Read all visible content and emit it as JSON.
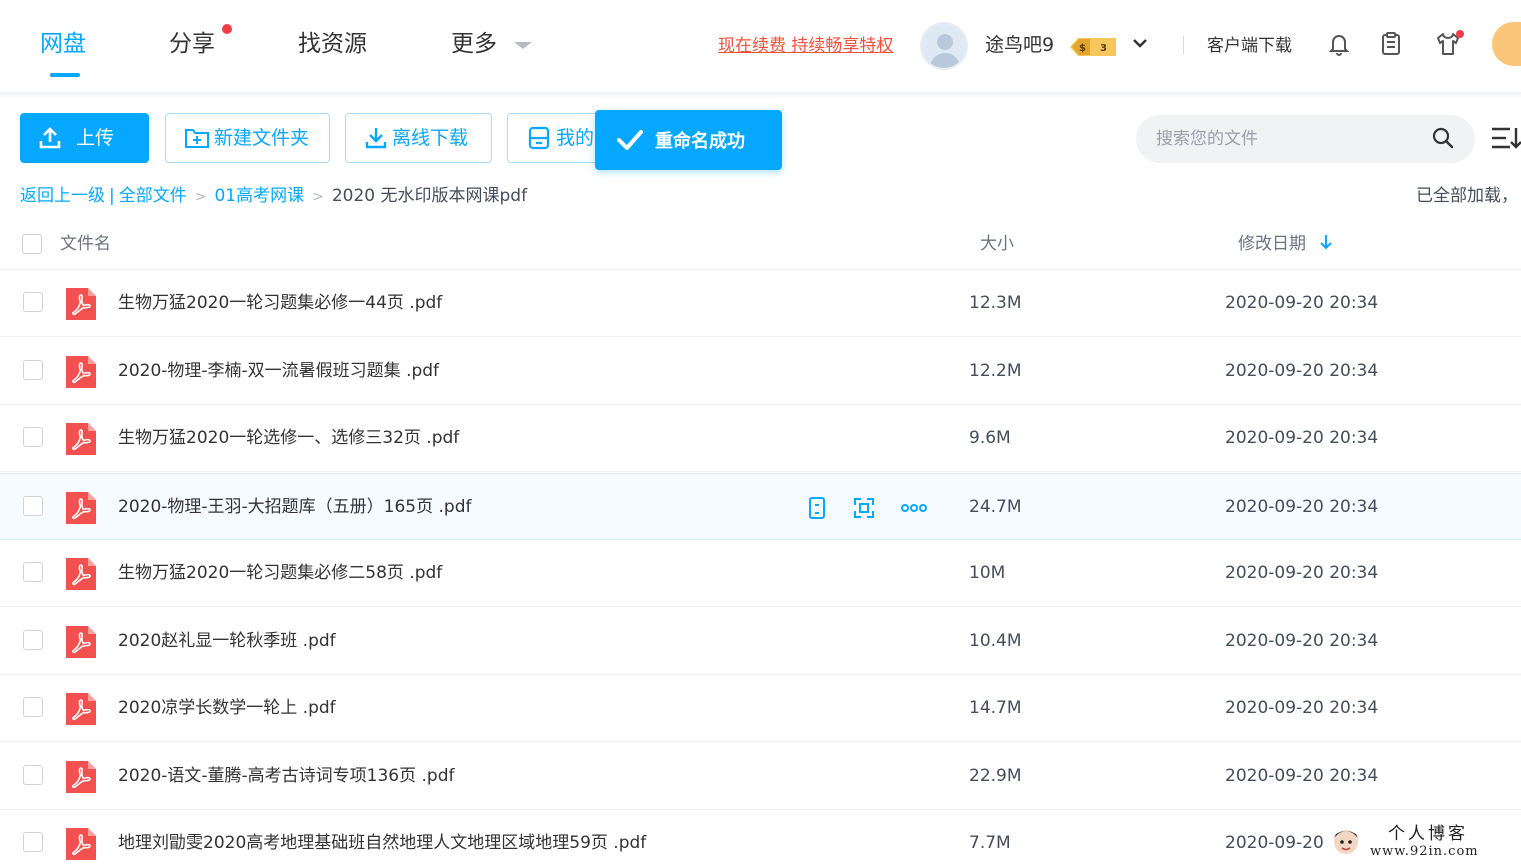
{
  "nav": {
    "items": [
      {
        "label": "网盘",
        "active": true
      },
      {
        "label": "分享",
        "has_dot": true
      },
      {
        "label": "找资源"
      },
      {
        "label": "更多"
      }
    ]
  },
  "user": {
    "renew_link": "现在续费 持续畅享特权",
    "name": "途鸟吧9",
    "vip_badge": "3",
    "client_download": "客户端下载"
  },
  "icons": {
    "bell": "bell-icon",
    "clipboard": "clipboard-icon",
    "shirt": "shirt-icon",
    "search": "search-icon",
    "sort": "sort-list-icon"
  },
  "toolbar": {
    "upload": "上传",
    "new_folder": "新建文件夹",
    "offline_download": "离线下载",
    "mine": "我的",
    "toast": "重命名成功",
    "search_placeholder": "搜索您的文件"
  },
  "breadcrumb": {
    "back": "返回上一级",
    "separator": "|",
    "all_files": "全部文件",
    "folder": "01高考网课",
    "current": "2020 无水印版本网课pdf",
    "loaded_status": "已全部加载，"
  },
  "table": {
    "headers": {
      "name": "文件名",
      "size": "大小",
      "date": "修改日期"
    },
    "rows": [
      {
        "name": "生物万猛2020一轮习题集必修一44页 .pdf",
        "size": "12.3M",
        "date": "2020-09-20 20:34"
      },
      {
        "name": "2020-物理-李楠-双一流暑假班习题集 .pdf",
        "size": "12.2M",
        "date": "2020-09-20 20:34"
      },
      {
        "name": "生物万猛2020一轮选修一、选修三32页 .pdf",
        "size": "9.6M",
        "date": "2020-09-20 20:34"
      },
      {
        "name": "2020-物理-王羽-大招题库（五册）165页 .pdf",
        "size": "24.7M",
        "date": "2020-09-20 20:34",
        "hover": true
      },
      {
        "name": "生物万猛2020一轮习题集必修二58页 .pdf",
        "size": "10M",
        "date": "2020-09-20 20:34"
      },
      {
        "name": "2020赵礼显一轮秋季班 .pdf",
        "size": "10.4M",
        "date": "2020-09-20 20:34"
      },
      {
        "name": "2020凉学长数学一轮上 .pdf",
        "size": "14.7M",
        "date": "2020-09-20 20:34"
      },
      {
        "name": "2020-语文-董腾-高考古诗词专项136页 .pdf",
        "size": "22.9M",
        "date": "2020-09-20 20:34"
      },
      {
        "name": "地理刘勖雯2020高考地理基础班自然地理人文地理区域地理59页 .pdf",
        "size": "7.7M",
        "date": "2020-09-20"
      }
    ]
  },
  "watermark": {
    "line1": "个人博客",
    "line2": "www.92in.com"
  },
  "colors": {
    "accent": "#06a7ff",
    "renew": "#f0523c",
    "pdf": "#f3514f",
    "hover_row": "#f5fbff"
  }
}
